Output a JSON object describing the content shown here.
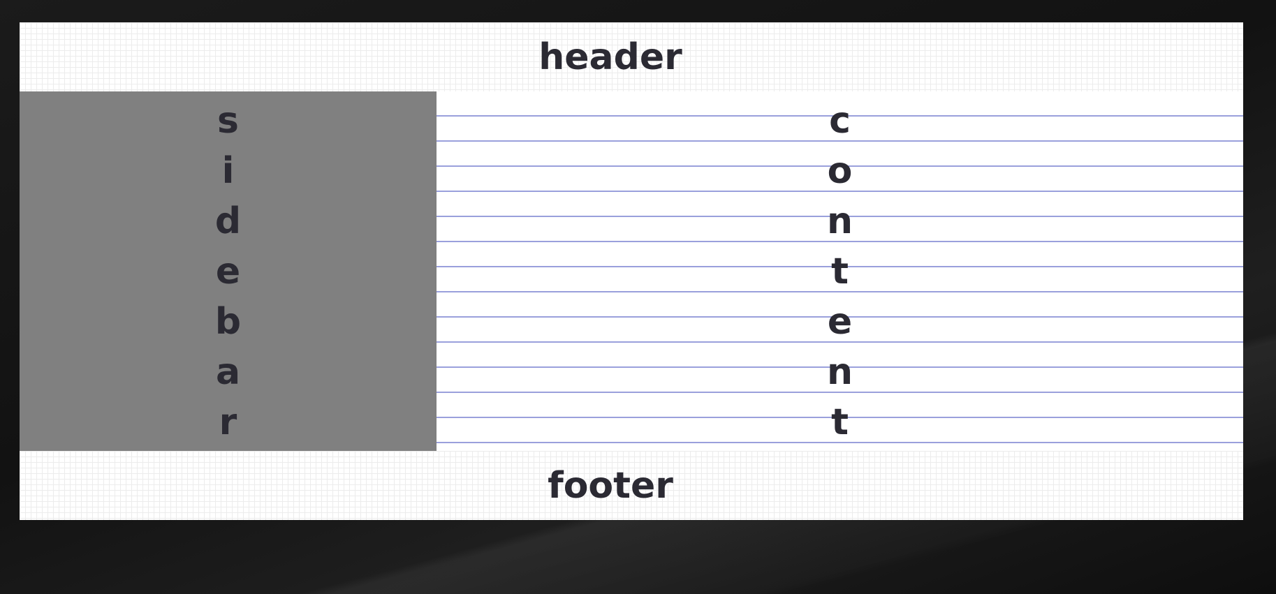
{
  "layout_demo": {
    "header": "header",
    "sidebar_letters": [
      "s",
      "i",
      "d",
      "e",
      "b",
      "a",
      "r"
    ],
    "content_letters": [
      "c",
      "o",
      "n",
      "t",
      "e",
      "n",
      "t"
    ],
    "footer": "footer"
  },
  "colors": {
    "page_background": "#141414",
    "sidebar_background": "#808080",
    "content_lines": "#9aa0dc",
    "text": "#2b2a33"
  }
}
